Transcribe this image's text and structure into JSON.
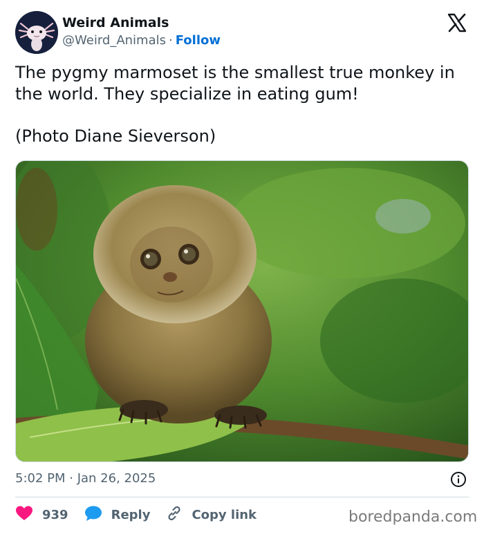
{
  "tweet": {
    "author": {
      "display_name": "Weird Animals",
      "handle": "@Weird_Animals",
      "separator": "·",
      "follow_label": "Follow"
    },
    "text": "The pygmy marmoset is the smallest true monkey in the world. They specialize in eating gum!",
    "credit": "(Photo Diane Sieverson)",
    "timestamp": "5:02 PM · Jan 26, 2025",
    "actions": {
      "like_count": "939",
      "reply_label": "Reply",
      "copy_label": "Copy link"
    }
  },
  "watermark": "boredpanda.com",
  "icons": {
    "platform_logo": "x-logo-icon",
    "info": "info-icon",
    "like": "heart-icon",
    "reply": "speech-bubble-icon",
    "copy": "link-icon"
  },
  "colors": {
    "follow_blue": "#006fd6",
    "like_red": "#f91880",
    "reply_blue": "#1d9bf0",
    "text_primary": "#0f1419",
    "text_secondary": "#536471"
  }
}
